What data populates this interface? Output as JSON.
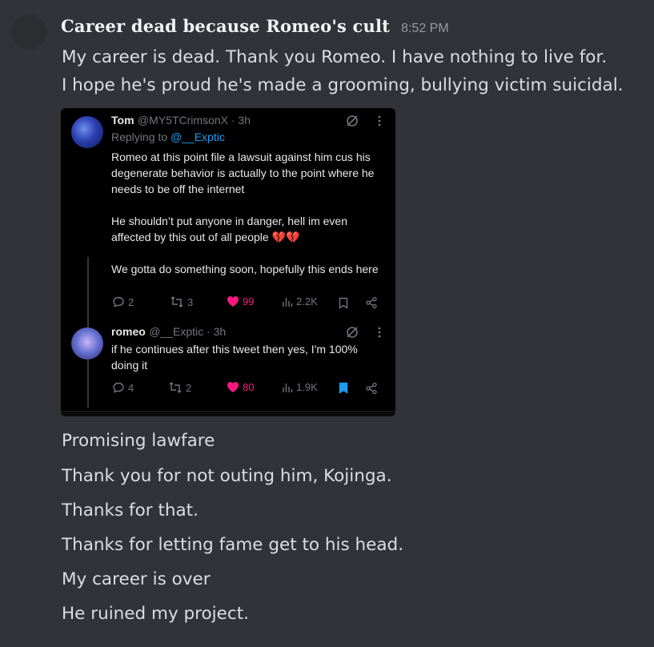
{
  "message": {
    "username": "Career dead because Romeo's cult",
    "timestamp": "8:52 PM",
    "lines_top": [
      "My career is dead. Thank you Romeo. I have nothing to live for.",
      "I hope he's proud he's made a grooming, bullying victim suicidal."
    ],
    "lines_bottom": [
      "Promising lawfare",
      "Thank you for not outing him, Kojinga.",
      "Thanks for that.",
      "Thanks for letting fame get to his head.",
      "My career is over",
      "He ruined my project."
    ]
  },
  "embed": {
    "tweet1": {
      "name": "Tom",
      "handle": "@MY5TCrimsonX · 3h",
      "replying_prefix": "Replying to ",
      "replying_to": "@__Exptic",
      "paragraphs": [
        "Romeo at this point file a lawsuit against him cus his degenerate behavior is actually to the point where he needs to be off the internet",
        "He shouldn’t put anyone in danger, hell im even affected by this out of all people 💔💔",
        "We gotta do something soon, hopefully this ends here"
      ],
      "replies": "2",
      "retweets": "3",
      "likes": "99",
      "views": "2.2K"
    },
    "tweet2": {
      "name": "romeo",
      "handle": "@__Exptic · 3h",
      "paragraphs": [
        "if he continues after this tweet then yes, I'm 100% doing it"
      ],
      "replies": "4",
      "retweets": "2",
      "likes": "80",
      "views": "1.9K"
    }
  },
  "colors": {
    "background": "#313338",
    "like": "#f91880",
    "bookmark_active": "#1d9bf0",
    "muted": "#71767b"
  }
}
